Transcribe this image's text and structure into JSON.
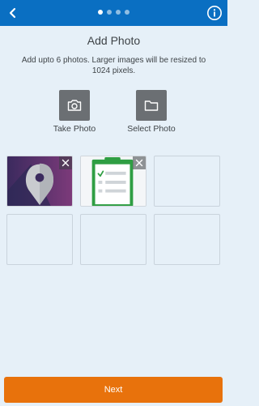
{
  "header": {
    "back_icon": "chevron-left-icon",
    "info_icon": "info-icon",
    "steps_total": 4,
    "step_current": 1,
    "bar_color": "#0a6fc2"
  },
  "page": {
    "title": "Add Photo",
    "subtitle": "Add upto 6 photos. Larger images will be resized to 1024 pixels."
  },
  "actions": {
    "take_photo": {
      "label": "Take Photo",
      "icon": "camera-icon"
    },
    "select_photo": {
      "label": "Select Photo",
      "icon": "folder-icon"
    }
  },
  "photos": {
    "max": 6,
    "slots": [
      {
        "state": "filled",
        "image": "map-pin-photo",
        "remove_icon": "close-icon"
      },
      {
        "state": "filled",
        "image": "checklist-photo",
        "remove_icon": "close-icon"
      },
      {
        "state": "empty"
      },
      {
        "state": "empty"
      },
      {
        "state": "empty"
      },
      {
        "state": "empty"
      }
    ]
  },
  "footer": {
    "next_label": "Next",
    "next_color": "#e8720c"
  }
}
